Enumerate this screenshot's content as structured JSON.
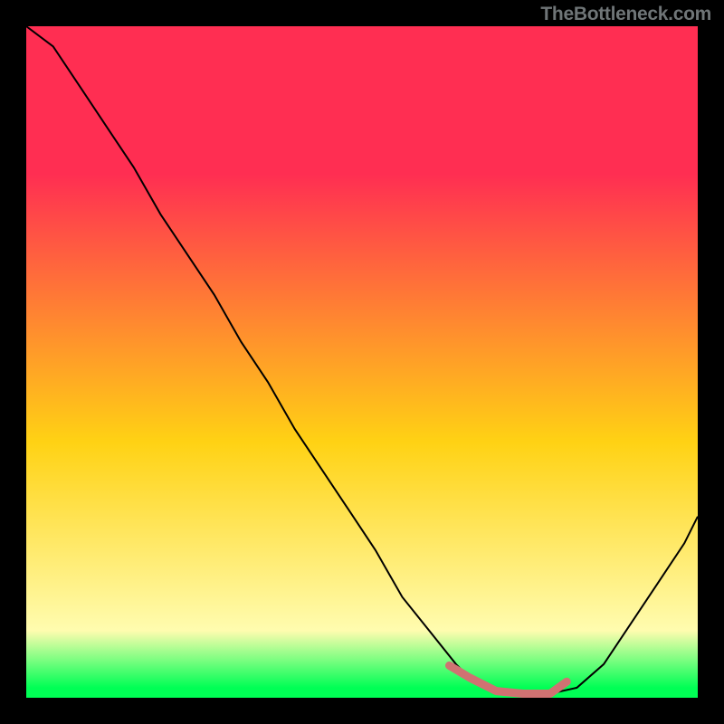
{
  "attribution": "TheBottleneck.com",
  "colors": {
    "frame": "#000000",
    "grad_top": "#ff2e52",
    "grad_mid": "#ffd214",
    "grad_low": "#fffcaf",
    "grad_bottom": "#00ff55",
    "curve": "#000000",
    "marker": "#d07272"
  },
  "chart_data": {
    "type": "line",
    "title": "",
    "xlabel": "",
    "ylabel": "",
    "xlim": [
      0,
      100
    ],
    "ylim": [
      0,
      100
    ],
    "x": [
      0,
      4,
      8,
      12,
      16,
      20,
      24,
      28,
      32,
      36,
      40,
      44,
      48,
      52,
      56,
      60,
      64,
      66,
      70,
      74,
      78,
      82,
      86,
      90,
      94,
      98,
      100
    ],
    "y": [
      100,
      97,
      91,
      85,
      79,
      72,
      66,
      60,
      53,
      47,
      40,
      34,
      28,
      22,
      15,
      10,
      5,
      3,
      1,
      0.6,
      0.6,
      1.5,
      5,
      11,
      17,
      23,
      27
    ],
    "highlight": {
      "x": [
        63,
        66,
        70,
        74,
        78,
        80.5
      ],
      "y": [
        4.8,
        3,
        1,
        0.6,
        0.6,
        2.4
      ]
    },
    "gradient_stops": [
      {
        "offset": 0.0,
        "color_key": "grad_top"
      },
      {
        "offset": 0.22,
        "color_key": "grad_top"
      },
      {
        "offset": 0.62,
        "color_key": "grad_mid"
      },
      {
        "offset": 0.9,
        "color_key": "grad_low"
      },
      {
        "offset": 0.985,
        "color_key": "grad_bottom"
      },
      {
        "offset": 1.0,
        "color_key": "grad_bottom"
      }
    ]
  }
}
